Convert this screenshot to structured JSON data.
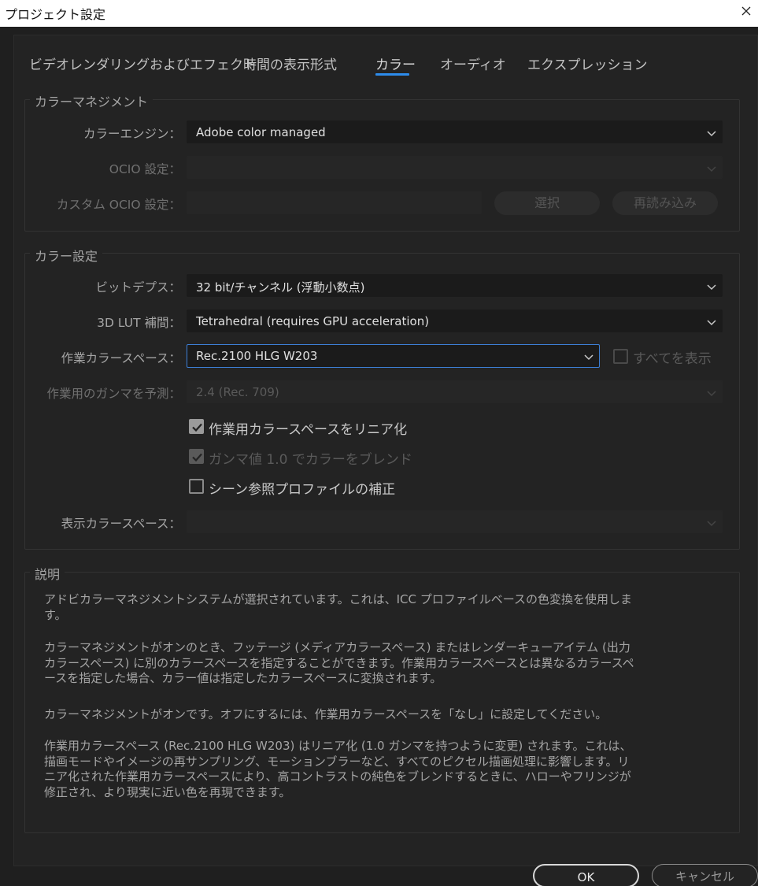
{
  "window": {
    "title": "プロジェクト設定"
  },
  "tabs": [
    {
      "label": "ビデオレンダリングおよびエフェクト"
    },
    {
      "label": "時間の表示形式"
    },
    {
      "label": "カラー"
    },
    {
      "label": "オーディオ"
    },
    {
      "label": "エクスプレッション"
    }
  ],
  "color_management": {
    "title": "カラーマネジメント",
    "engine_label": "カラーエンジン：",
    "engine_value": "Adobe color managed",
    "ocio_label": "OCIO 設定：",
    "ocio_value": "",
    "custom_ocio_label": "カスタム OCIO 設定：",
    "custom_ocio_value": "",
    "select_button": "選択",
    "reload_button": "再読み込み"
  },
  "color_settings": {
    "title": "カラー設定",
    "bit_depth_label": "ビットデプス：",
    "bit_depth_value": "32 bit/チャンネル (浮動小数点)",
    "lut_label": "3D LUT 補間：",
    "lut_value": "Tetrahedral (requires GPU acceleration)",
    "working_space_label": "作業カラースペース：",
    "working_space_value": "Rec.2100 HLG W203",
    "show_all_label": "すべてを表示",
    "show_all_checked": false,
    "gamma_label": "作業用のガンマを予測：",
    "gamma_value": "2.4 (Rec. 709)",
    "linearize_label": "作業用カラースペースをリニア化",
    "linearize_checked": true,
    "blend_label": "ガンマ値 1.0 でカラーをブレンド",
    "blend_checked": true,
    "scene_label": "シーン参照プロファイルの補正",
    "scene_checked": false,
    "display_label": "表示カラースペース：",
    "display_value": ""
  },
  "description": {
    "title": "説明",
    "p1": "アドビカラーマネジメントシステムが選択されています。これは、ICC プロファイルベースの色変換を使用します。",
    "p2": "カラーマネジメントがオンのとき、フッテージ (メディアカラースペース) またはレンダーキューアイテム (出力カラースペース) に別のカラースペースを指定することができます。作業用カラースペースとは異なるカラースペースを指定した場合、カラー値は指定したカラースペースに変換されます。",
    "p3": "カラーマネジメントがオンです。オフにするには、作業用カラースペースを「なし」に設定してください。",
    "p4": "作業用カラースペース (Rec.2100 HLG W203) はリニア化 (1.0 ガンマを持つように変更) されます。これは、描画モードやイメージの再サンプリング、モーションブラーなど、すべてのピクセル描画処理に影響します。リニア化された作業用カラースペースにより、高コントラストの純色をブレンドするときに、ハローやフリンジが修正され、より現実に近い色を再現できます。"
  },
  "buttons": {
    "ok": "OK",
    "cancel": "キャンセル"
  }
}
